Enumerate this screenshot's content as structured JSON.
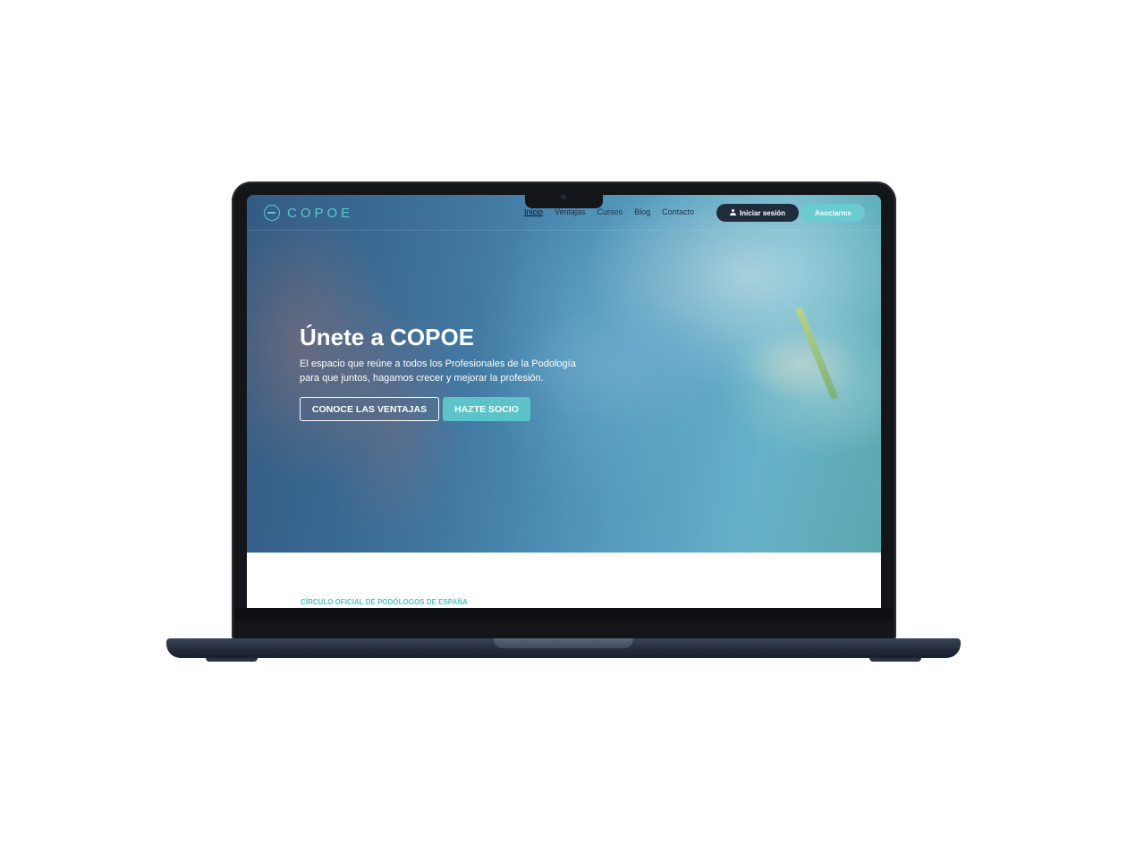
{
  "brand": {
    "name": "COPOE"
  },
  "nav": {
    "items": [
      {
        "label": "Inicio",
        "active": true
      },
      {
        "label": "Ventajas",
        "active": false
      },
      {
        "label": "Cursos",
        "active": false
      },
      {
        "label": "Blog",
        "active": false
      },
      {
        "label": "Contacto",
        "active": false
      }
    ],
    "login_label": "Iniciar sesión",
    "join_label": "Asociarme"
  },
  "hero": {
    "title": "Únete a COPOE",
    "subtitle_line1": "El espacio que reúne a todos los Profesionales de la Podología",
    "subtitle_line2": "para que juntos, hagamos crecer y mejorar la profesión.",
    "primary_button": "CONOCE LAS VENTAJAS",
    "secondary_button": "HAZTE SOCIO"
  },
  "section": {
    "eyebrow": "CÍRCULO OFICIAL DE PODÓLOGOS DE ESPAÑA"
  },
  "colors": {
    "accent": "#5fc6c8",
    "dark": "#1f2c3b",
    "hero_blue": "#4b88b3"
  },
  "icons": {
    "login": "user-icon",
    "logo": "logo-circle-icon"
  }
}
